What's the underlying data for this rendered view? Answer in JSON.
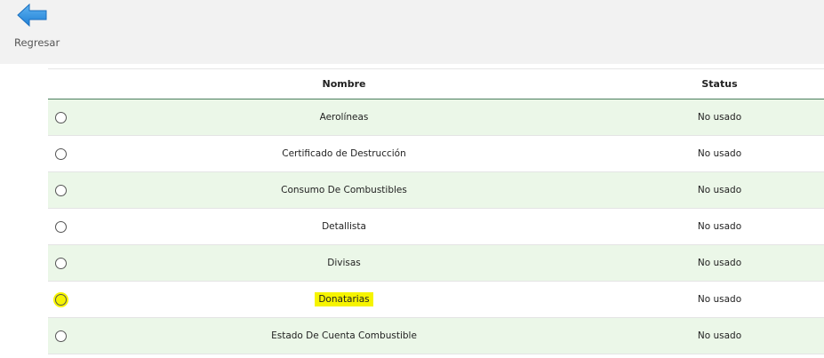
{
  "toolbar": {
    "back_label": "Regresar"
  },
  "table": {
    "columns": {
      "name": "Nombre",
      "status": "Status"
    },
    "rows": [
      {
        "name": "Aerolíneas",
        "status": "No usado"
      },
      {
        "name": "Certificado de Destrucción",
        "status": "No usado"
      },
      {
        "name": "Consumo De Combustibles",
        "status": "No usado"
      },
      {
        "name": "Detallista",
        "status": "No usado"
      },
      {
        "name": "Divisas",
        "status": "No usado"
      },
      {
        "name": "Donatarias",
        "status": "No usado"
      },
      {
        "name": "Estado De Cuenta Combustible",
        "status": "No usado"
      }
    ]
  },
  "highlight_color": "#f6f400",
  "row_alt_color": "#ebf7e8",
  "header_border_color": "#4a7f5e"
}
